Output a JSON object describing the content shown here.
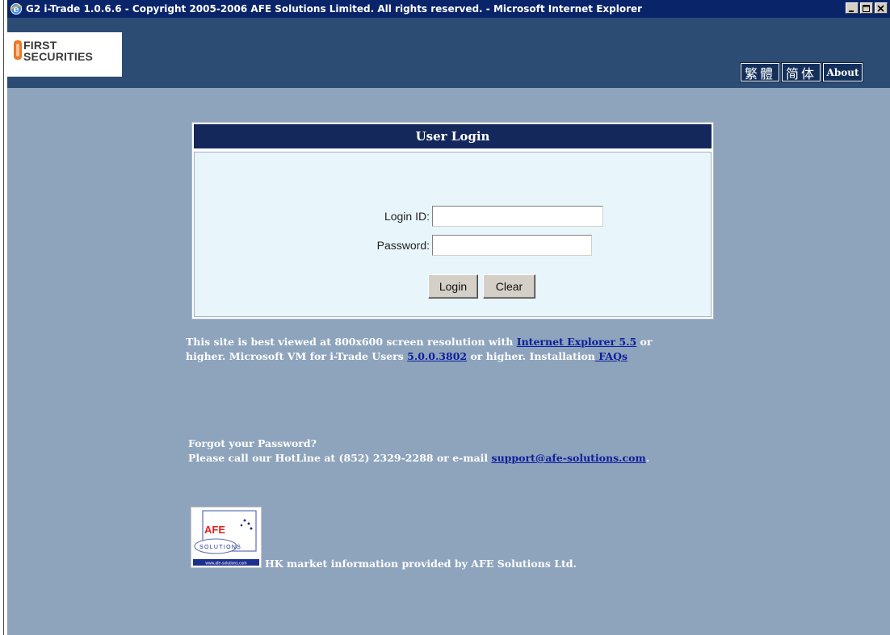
{
  "window": {
    "title": "G2 i-Trade 1.0.6.6 - Copyright 2005-2006 AFE Solutions Limited. All rights reserved. - Microsoft Internet Explorer"
  },
  "brand": {
    "line1": "FIRST",
    "line2": "SECURITIES"
  },
  "lang": {
    "traditional": "繁體",
    "simplified": "简体",
    "about": "About"
  },
  "login": {
    "title": "User Login",
    "login_id_label": "Login ID:",
    "login_id_value": "",
    "password_label": "Password:",
    "password_value": "",
    "login_button": "Login",
    "clear_button": "Clear"
  },
  "notice": {
    "part1": "This site is best viewed at 800x600 screen resolution with ",
    "ie_link": "Internet Explorer 5.5",
    "part2": " or",
    "part3": "higher. Microsoft VM for i-Trade Users ",
    "vm_link": "5.0.0.3802",
    "part4": " or higher. Installation",
    "faq_link": " FAQs"
  },
  "forgot": {
    "line1": "Forgot your Password?",
    "line2": "Please call our HotLine at (852) 2329-2288 or e-mail ",
    "email_link": "support@afe-solutions.com",
    "line2_end": "."
  },
  "afe": {
    "logo_text": "AFE",
    "logo_sub": "SOLUTIONS",
    "logo_url": "www.afe-solutions.com",
    "caption": "HK market information provided by AFE Solutions Ltd."
  }
}
